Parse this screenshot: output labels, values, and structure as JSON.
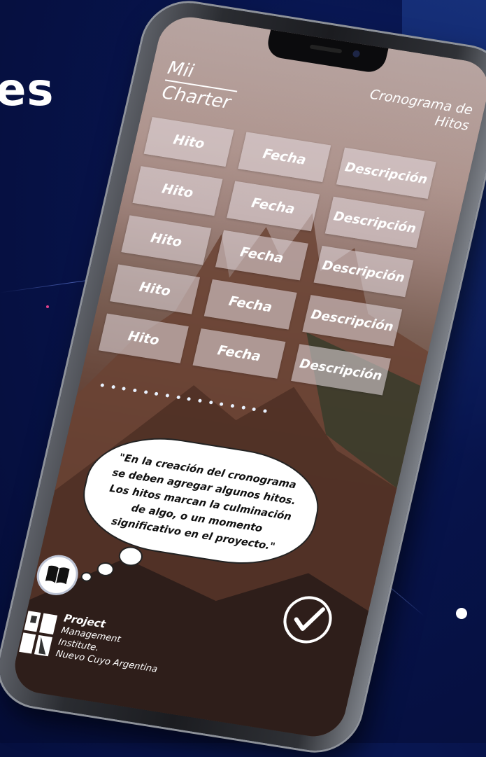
{
  "background": {
    "heading_fragment": "es"
  },
  "app": {
    "title_left_line1": "Mii",
    "title_left_line2": "Charter",
    "title_right_line1": "Cronograma de",
    "title_right_line2": "Hitos"
  },
  "table": {
    "rows": [
      {
        "hito": "Hito",
        "fecha": "Fecha",
        "descripcion": "Descripción"
      },
      {
        "hito": "Hito",
        "fecha": "Fecha",
        "descripcion": "Descripción"
      },
      {
        "hito": "Hito",
        "fecha": "Fecha",
        "descripcion": "Descripción"
      },
      {
        "hito": "Hito",
        "fecha": "Fecha",
        "descripcion": "Descripción"
      },
      {
        "hito": "Hito",
        "fecha": "Fecha",
        "descripcion": "Descripción"
      }
    ]
  },
  "tip": {
    "line1": "\"En la creación del cronograma",
    "line2": "se deben agregar algunos hitos.",
    "line3": "Los hitos marcan la culminación",
    "line4": "de algo, o un momento",
    "line5": "significativo en el proyecto.\""
  },
  "icons": {
    "book": "book-icon",
    "check": "checkmark-icon"
  },
  "footer": {
    "line1": "Project",
    "line2": "Management",
    "line3": "Institute.",
    "line4": "Nuevo Cuyo Argentina"
  },
  "colors": {
    "background": "#07134a",
    "cell": "#e6dce1",
    "text": "#ffffff"
  }
}
